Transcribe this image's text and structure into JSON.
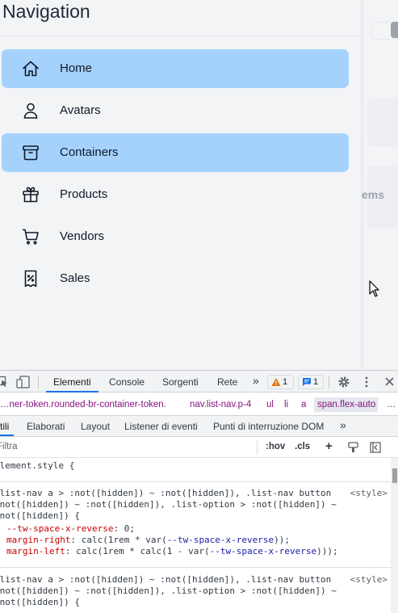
{
  "panel": {
    "title": "Navigation",
    "items": [
      {
        "label": "Home",
        "icon": "home-icon",
        "active": true
      },
      {
        "label": "Avatars",
        "icon": "user-icon",
        "active": false
      },
      {
        "label": "Containers",
        "icon": "archive-box-icon",
        "active": true
      },
      {
        "label": "Products",
        "icon": "gift-icon",
        "active": false
      },
      {
        "label": "Vendors",
        "icon": "cart-icon",
        "active": false
      },
      {
        "label": "Sales",
        "icon": "receipt-percent-icon",
        "active": false
      }
    ]
  },
  "background": {
    "partial_text": "ems"
  },
  "devtools": {
    "tabs": [
      "Elementi",
      "Console",
      "Sorgenti",
      "Rete"
    ],
    "more": "»",
    "warnings": "1",
    "messages": "1",
    "breadcrumbs": [
      "…ner-token.rounded-br-container-token.",
      "nav.list-nav.p-4",
      "ul",
      "li",
      "a",
      "span.flex-auto",
      "…"
    ],
    "subtabs": [
      "Stili",
      "Elaborati",
      "Layout",
      "Listener di eventi",
      "Punti di interruzione DOM",
      "»"
    ],
    "filter_placeholder": "Filtra",
    "hov": ":hov",
    "cls": ".cls",
    "plus": "+",
    "style_lines": {
      "element_style": "element.style {",
      "rule1_sel1": ".list-nav a > :not([hidden]) ~ :not([hidden]), .list-nav button",
      "rule1_sel2": ":not([hidden]) ~ :not([hidden]), .list-option > :not([hidden]) ~",
      "rule1_sel3": ":not([hidden]) {",
      "rule1_p1_name": "--tw-space-x-reverse",
      "rule1_p1_val": ": 0;",
      "rule1_p2_name": "margin-right",
      "rule1_p2_val": ": calc(1rem * var(",
      "rule1_p2_var": "--tw-space-x-reverse",
      "rule1_p2_end": "));",
      "rule1_p3_name": "margin-left",
      "rule1_p3_val": ": calc(1rem * calc(1 - var(",
      "rule1_p3_var": "--tw-space-x-reverse",
      "rule1_p3_end": ")));",
      "source": "<style>",
      "rule2_sel1": ".list-nav a > :not([hidden]) ~ :not([hidden]), .list-nav button",
      "rule2_sel2": ":not([hidden]) ~ :not([hidden]), .list-option > :not([hidden]) ~",
      "rule2_sel3": ":not([hidden]) {"
    }
  }
}
